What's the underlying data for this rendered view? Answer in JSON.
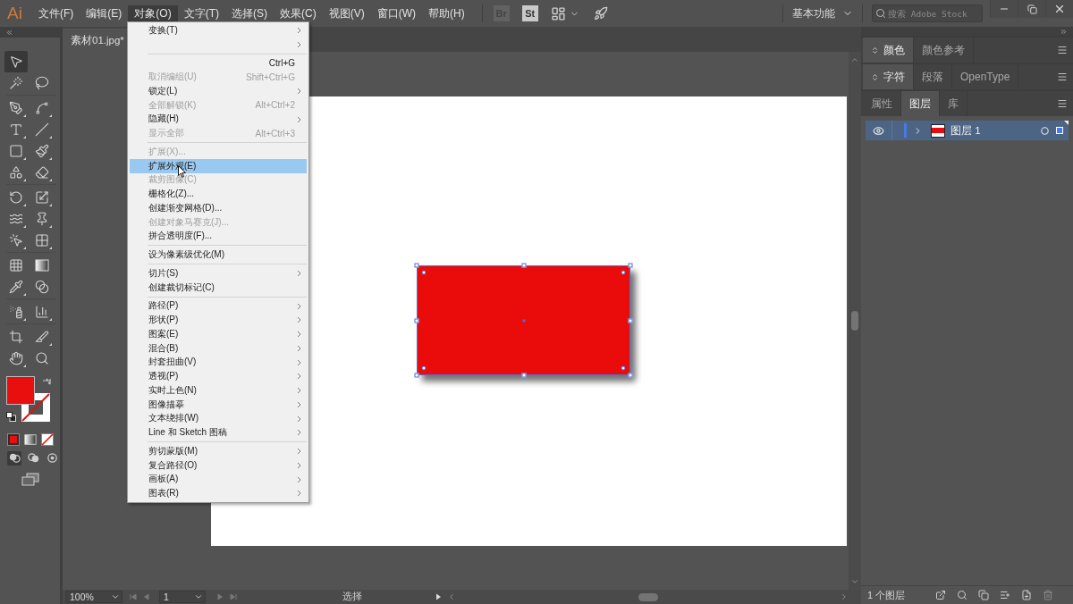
{
  "menubar": {
    "logo": "Ai",
    "menus": [
      {
        "label": "文件(F)",
        "selected": false
      },
      {
        "label": "编辑(E)",
        "selected": false
      },
      {
        "label": "对象(O)",
        "selected": true
      },
      {
        "label": "文字(T)",
        "selected": false
      },
      {
        "label": "选择(S)",
        "selected": false
      },
      {
        "label": "效果(C)",
        "selected": false
      },
      {
        "label": "视图(V)",
        "selected": false
      },
      {
        "label": "窗口(W)",
        "selected": false
      },
      {
        "label": "帮助(H)",
        "selected": false
      }
    ],
    "apps": [
      {
        "label": "Br",
        "disabled": true
      },
      {
        "label": "St",
        "disabled": false
      }
    ],
    "workspace": "基本功能",
    "search": {
      "placeholder": "搜索 Adobe Stock"
    }
  },
  "document": {
    "tab": "素材01.jpg*"
  },
  "tools": {
    "groups": [
      [
        [
          {
            "kind": "selection",
            "selected": true,
            "flyout": false
          }
        ],
        [
          {
            "kind": "magic_wand",
            "selected": false,
            "flyout": false
          },
          {
            "kind": "lasso",
            "selected": false,
            "flyout": false
          }
        ]
      ],
      [
        [
          {
            "kind": "pen",
            "selected": false,
            "flyout": true
          },
          {
            "kind": "curvature",
            "selected": false,
            "flyout": true
          }
        ],
        [
          {
            "kind": "type",
            "selected": false,
            "flyout": true
          },
          {
            "kind": "line",
            "selected": false,
            "flyout": true
          }
        ],
        [
          {
            "kind": "rectangle",
            "selected": false,
            "flyout": true
          },
          {
            "kind": "paintbrush",
            "selected": false,
            "flyout": true
          }
        ],
        [
          {
            "kind": "shaper",
            "selected": false,
            "flyout": true
          },
          {
            "kind": "eraser",
            "selected": false,
            "flyout": true
          }
        ]
      ],
      [
        [
          {
            "kind": "rotate",
            "selected": false,
            "flyout": true
          },
          {
            "kind": "scale",
            "selected": false,
            "flyout": true
          }
        ],
        [
          {
            "kind": "width",
            "selected": false,
            "flyout": true
          },
          {
            "kind": "pin",
            "selected": false,
            "flyout": true
          }
        ],
        [
          {
            "kind": "shape_builder",
            "selected": false,
            "flyout": true
          },
          {
            "kind": "perspective",
            "selected": false,
            "flyout": true
          }
        ]
      ],
      [
        [
          {
            "kind": "mesh",
            "selected": false,
            "flyout": false
          },
          {
            "kind": "gradient",
            "selected": false,
            "flyout": false
          }
        ],
        [
          {
            "kind": "eyedropper",
            "selected": false,
            "flyout": true
          },
          {
            "kind": "blend",
            "selected": false,
            "flyout": false
          }
        ]
      ],
      [
        [
          {
            "kind": "symbol_sprayer",
            "selected": false,
            "flyout": true
          },
          {
            "kind": "graph",
            "selected": false,
            "flyout": true
          }
        ]
      ],
      [
        [
          {
            "kind": "artboard",
            "selected": false,
            "flyout": false
          },
          {
            "kind": "slice",
            "selected": false,
            "flyout": true
          }
        ],
        [
          {
            "kind": "hand",
            "selected": false,
            "flyout": true
          },
          {
            "kind": "zoom",
            "selected": false,
            "flyout": false
          }
        ]
      ]
    ]
  },
  "fill": {
    "color": "#ea0f0f"
  },
  "draw_modes": [
    {
      "kind": "normal",
      "selected": true
    },
    {
      "kind": "behind",
      "selected": false
    },
    {
      "kind": "inside",
      "selected": false
    }
  ],
  "object_menu": {
    "items": [
      {
        "kind": "item",
        "label": "变换(T)",
        "submenu": true,
        "disabled": false,
        "selected": false
      },
      {
        "kind": "item",
        "submenu": true,
        "disabled": false,
        "selected": false
      },
      {
        "kind": "separator"
      },
      {
        "kind": "item",
        "shortcut": "Ctrl+G",
        "submenu": false,
        "disabled": false,
        "selected": false
      },
      {
        "kind": "item",
        "label": "取消编组(U)",
        "shortcut": "Shift+Ctrl+G",
        "submenu": false,
        "disabled": true,
        "selected": false
      },
      {
        "kind": "item",
        "label": "锁定(L)",
        "submenu": true,
        "disabled": false,
        "selected": false
      },
      {
        "kind": "item",
        "label": "全部解锁(K)",
        "shortcut": "Alt+Ctrl+2",
        "submenu": false,
        "disabled": true,
        "selected": false
      },
      {
        "kind": "item",
        "label": "隐藏(H)",
        "submenu": true,
        "disabled": false,
        "selected": false
      },
      {
        "kind": "item",
        "label": "显示全部",
        "shortcut": "Alt+Ctrl+3",
        "submenu": false,
        "disabled": true,
        "selected": false
      },
      {
        "kind": "separator"
      },
      {
        "kind": "item",
        "label": "扩展(X)...",
        "submenu": false,
        "disabled": true,
        "selected": false
      },
      {
        "kind": "item",
        "label": "扩展外观(E)",
        "submenu": false,
        "disabled": false,
        "selected": true
      },
      {
        "kind": "item",
        "label": "裁剪图像(C)",
        "submenu": false,
        "disabled": true,
        "selected": false
      },
      {
        "kind": "item",
        "label": "栅格化(Z)...",
        "submenu": false,
        "disabled": false,
        "selected": false
      },
      {
        "kind": "item",
        "label": "创建渐变网格(D)...",
        "submenu": false,
        "disabled": false,
        "selected": false
      },
      {
        "kind": "item",
        "label": "创建对象马赛克(J)...",
        "submenu": false,
        "disabled": true,
        "selected": false
      },
      {
        "kind": "item",
        "label": "拼合透明度(F)...",
        "submenu": false,
        "disabled": false,
        "selected": false
      },
      {
        "kind": "separator"
      },
      {
        "kind": "item",
        "label": "设为像素级优化(M)",
        "submenu": false,
        "disabled": false,
        "selected": false
      },
      {
        "kind": "separator"
      },
      {
        "kind": "item",
        "label": "切片(S)",
        "submenu": true,
        "disabled": false,
        "selected": false
      },
      {
        "kind": "item",
        "label": "创建裁切标记(C)",
        "submenu": false,
        "disabled": false,
        "selected": false
      },
      {
        "kind": "separator"
      },
      {
        "kind": "item",
        "label": "路径(P)",
        "submenu": true,
        "disabled": false,
        "selected": false
      },
      {
        "kind": "item",
        "label": "形状(P)",
        "submenu": true,
        "disabled": false,
        "selected": false
      },
      {
        "kind": "item",
        "label": "图案(E)",
        "submenu": true,
        "disabled": false,
        "selected": false
      },
      {
        "kind": "item",
        "label": "混合(B)",
        "submenu": true,
        "disabled": false,
        "selected": false
      },
      {
        "kind": "item",
        "label": "封套扭曲(V)",
        "submenu": true,
        "disabled": false,
        "selected": false
      },
      {
        "kind": "item",
        "label": "透视(P)",
        "submenu": true,
        "disabled": false,
        "selected": false
      },
      {
        "kind": "item",
        "label": "实时上色(N)",
        "submenu": true,
        "disabled": false,
        "selected": false
      },
      {
        "kind": "item",
        "label": "图像描摹",
        "submenu": true,
        "disabled": false,
        "selected": false
      },
      {
        "kind": "item",
        "label": "文本绕排(W)",
        "submenu": true,
        "disabled": false,
        "selected": false
      },
      {
        "kind": "item",
        "label": "Line 和 Sketch 图稿",
        "submenu": true,
        "disabled": false,
        "selected": false
      },
      {
        "kind": "separator"
      },
      {
        "kind": "item",
        "label": "剪切蒙版(M)",
        "submenu": true,
        "disabled": false,
        "selected": false
      },
      {
        "kind": "item",
        "label": "复合路径(O)",
        "submenu": true,
        "disabled": false,
        "selected": false
      },
      {
        "kind": "item",
        "label": "画板(A)",
        "submenu": true,
        "disabled": false,
        "selected": false
      },
      {
        "kind": "item",
        "label": "图表(R)",
        "submenu": true,
        "disabled": false,
        "selected": false
      }
    ]
  },
  "canvas": {
    "artwork": [
      {
        "kind": "rectangle",
        "color": "#ea0b0b",
        "selected": true
      }
    ]
  },
  "status_bar": {
    "zoom": "100%",
    "artboard": "1",
    "tool": "选择"
  },
  "panels": {
    "groups": [
      {
        "collapsible": true,
        "tabs": [
          {
            "label": "颜色",
            "selected": true
          },
          {
            "label": "颜色参考",
            "selected": false
          }
        ]
      },
      {
        "collapsible": true,
        "tabs": [
          {
            "label": "字符",
            "selected": true
          },
          {
            "label": "段落",
            "selected": false
          },
          {
            "label": "OpenType",
            "selected": false
          }
        ]
      },
      {
        "collapsible": false,
        "tabs": [
          {
            "label": "属性",
            "selected": false
          },
          {
            "label": "图层",
            "selected": true
          },
          {
            "label": "库",
            "selected": false
          }
        ]
      }
    ]
  },
  "layers": {
    "items": [
      {
        "name": "图层 1",
        "visible": true,
        "expanded": false,
        "selected": true,
        "color": "#4a78e6"
      }
    ],
    "count": "1 个图层"
  }
}
